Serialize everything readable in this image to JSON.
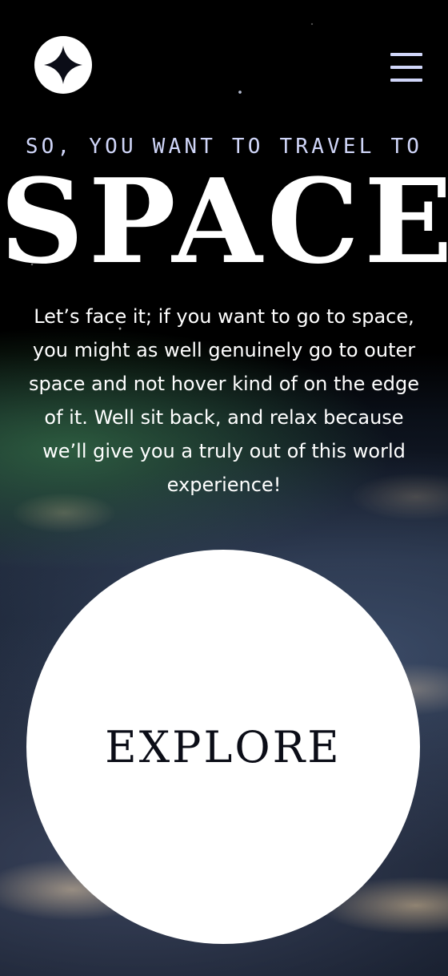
{
  "header": {
    "logo_icon": "sparkle-star-logo-icon",
    "menu_icon": "hamburger-menu-icon"
  },
  "hero": {
    "kicker": "SO, YOU WANT TO TRAVEL TO",
    "title": "SPACE",
    "body": "Let’s face it; if you want to go to space, you might as well genuinely go to outer space and not hover kind of on the edge of it. Well sit back, and relax because we’ll give you a truly out of this world experience!",
    "explore_label": "EXPLORE"
  },
  "colors": {
    "kicker": "#D0D6F9",
    "explore_text": "#0B0D17",
    "explore_bg": "#FFFFFF"
  }
}
